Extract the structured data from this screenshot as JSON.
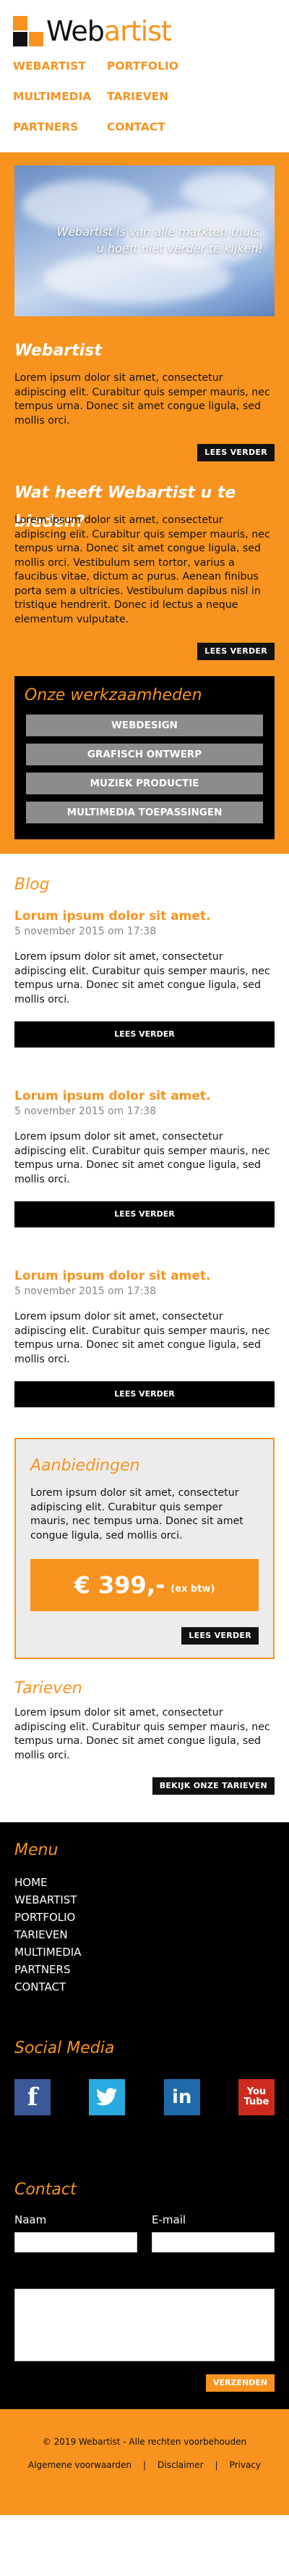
{
  "brand": {
    "logo_text_a": "Web",
    "logo_text_b": "artist"
  },
  "nav": [
    "WEBARTIST",
    "PORTFOLIO",
    "MULTIMEDIA",
    "TARIEVEN",
    "PARTNERS",
    "CONTACT"
  ],
  "hero": {
    "caption_line1": "Webartist is van alle markten thuis,",
    "caption_line2": "u hoeft niet verder te kijken!"
  },
  "intro": {
    "title": "Webartist",
    "text": "Lorem ipsum dolor sit amet, consectetur adipiscing elit. Curabitur quis semper mauris, nec tempus urna. Donec sit amet congue ligula, sed mollis orci.",
    "button": "LEES VERDER"
  },
  "offer": {
    "title": "Wat heeft Webartist u te bieden?",
    "text": "Lorem ipsum dolor sit amet, consectetur adipiscing elit. Curabitur quis semper mauris, nec tempus urna. Donec sit amet congue ligula, sed mollis orci. Vestibulum sem tortor, varius a faucibus vitae, dictum ac purus. Aenean finibus porta sem a ultricies. Vestibulum dapibus nisl in tristique hendrerit. Donec id lectus a neque elementum vulputate.",
    "button": "LEES VERDER"
  },
  "werk": {
    "title": "Onze werkzaamheden",
    "items": [
      "WEBDESIGN",
      "GRAFISCH ONTWERP",
      "MUZIEK PRODUCTIE",
      "MULTIMEDIA TOEPASSINGEN"
    ]
  },
  "blog": {
    "title": "Blog",
    "posts": [
      {
        "title": "Lorum ipsum dolor sit amet.",
        "date": "5 november 2015 om 17:38",
        "text": "Lorem ipsum dolor sit amet, consectetur adipiscing elit. Curabitur quis semper mauris, nec tempus urna. Donec sit amet congue ligula, sed mollis orci.",
        "button": "LEES VERDER"
      },
      {
        "title": "Lorum ipsum dolor sit amet.",
        "date": "5 november 2015 om 17:38",
        "text": "Lorem ipsum dolor sit amet, consectetur adipiscing elit. Curabitur quis semper mauris, nec tempus urna. Donec sit amet congue ligula, sed mollis orci.",
        "button": "LEES VERDER"
      },
      {
        "title": "Lorum ipsum dolor sit amet.",
        "date": "5 november 2015 om 17:38",
        "text": "Lorem ipsum dolor sit amet, consectetur adipiscing elit. Curabitur quis semper mauris, nec tempus urna. Donec sit amet congue ligula, sed mollis orci.",
        "button": "LEES VERDER"
      }
    ]
  },
  "aanbiedingen": {
    "title": "Aanbiedingen",
    "text": "Lorem ipsum dolor sit amet, consectetur adipiscing elit. Curabitur quis semper mauris, nec tempus urna. Donec sit amet congue ligula, sed mollis orci.",
    "price": "€ 399,-",
    "price_note": "(ex btw)",
    "button": "LEES VERDER"
  },
  "tarieven": {
    "title": "Tarieven",
    "text": "Lorem ipsum dolor sit amet, consectetur adipiscing elit. Curabitur quis semper mauris, nec tempus urna. Donec sit amet congue ligula, sed mollis orci.",
    "button": "BEKIJK ONZE TARIEVEN"
  },
  "footer_menu": {
    "title": "Menu",
    "items": [
      "HOME",
      "WEBARTIST",
      "PORTFOLIO",
      "TARIEVEN",
      "MULTIMEDIA",
      "PARTNERS",
      "CONTACT"
    ]
  },
  "social": {
    "title": "Social Media",
    "items": [
      {
        "name": "facebook-icon",
        "glyph": "f",
        "color": "#3b5998"
      },
      {
        "name": "twitter-icon",
        "glyph": "🐦",
        "color": "#29aae1"
      },
      {
        "name": "linkedin-icon",
        "glyph": "in",
        "color": "#1f6aa8"
      },
      {
        "name": "youtube-icon",
        "glyph_a": "You",
        "glyph_b": "Tube",
        "color": "#cc2a1d"
      }
    ]
  },
  "contact": {
    "title": "Contact",
    "name_label": "Naam",
    "email_label": "E-mail",
    "button": "VERZENDEN"
  },
  "bottom": {
    "copyright": "© 2019 Webartist - Alle rechten voorbehouden",
    "links": [
      "Algemene voorwaarden",
      "Disclaimer",
      "Privacy"
    ]
  },
  "colors": {
    "accent": "#f7931e",
    "dark": "#000000",
    "grey_button": "#8c8c8c"
  }
}
